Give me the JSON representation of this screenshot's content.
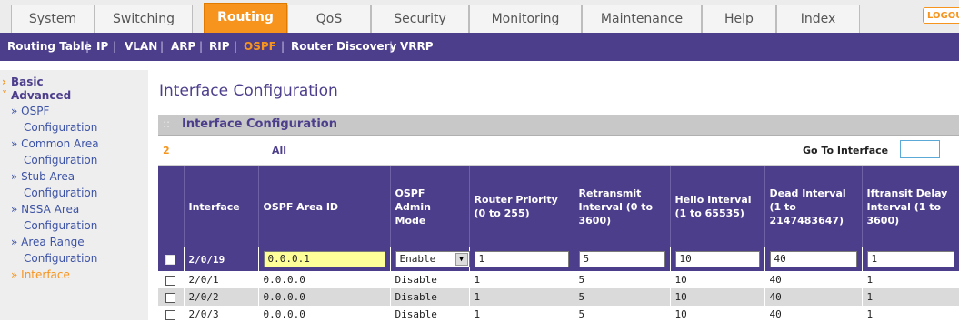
{
  "top_tabs": [
    {
      "label": "System",
      "active": false
    },
    {
      "label": "Switching",
      "active": false
    },
    {
      "label": "Routing",
      "active": true
    },
    {
      "label": "QoS",
      "active": false
    },
    {
      "label": "Security",
      "active": false
    },
    {
      "label": "Monitoring",
      "active": false
    },
    {
      "label": "Maintenance",
      "active": false
    },
    {
      "label": "Help",
      "active": false
    },
    {
      "label": "Index",
      "active": false
    }
  ],
  "logout_label": "LOGOU",
  "subnav": [
    {
      "label": "Routing Table",
      "active": false
    },
    {
      "label": "IP",
      "active": false
    },
    {
      "label": "VLAN",
      "active": false
    },
    {
      "label": "ARP",
      "active": false
    },
    {
      "label": "RIP",
      "active": false
    },
    {
      "label": "OSPF",
      "active": true
    },
    {
      "label": "Router Discovery",
      "active": false
    },
    {
      "label": "VRRP",
      "active": false
    }
  ],
  "sidebar": {
    "basic": "Basic",
    "advanced": "Advanced",
    "items": [
      {
        "line1": "» OSPF",
        "line2": "Configuration"
      },
      {
        "line1": "» Common Area",
        "line2": "Configuration"
      },
      {
        "line1": "» Stub Area",
        "line2": "Configuration"
      },
      {
        "line1": "» NSSA Area",
        "line2": "Configuration"
      },
      {
        "line1": "» Area Range",
        "line2": "Configuration"
      },
      {
        "line1": "» Interface",
        "line2": ""
      }
    ]
  },
  "page_title": "Interface Configuration",
  "section_title": "Interface Configuration",
  "section_marker": "::",
  "controls": {
    "slot": "2",
    "all": "All",
    "goto_label": "Go To Interface",
    "goto_value": ""
  },
  "columns": [
    "Interface",
    "OSPF Area ID",
    "OSPF Admin Mode",
    "Router Priority (0 to 255)",
    "Retransmit Interval (0 to 3600)",
    "Hello Interval (1 to 65535)",
    "Dead Interval (1 to 2147483647)",
    "Iftransit Delay Interval (1 to 3600)"
  ],
  "edit_row": {
    "interface": "2/0/19",
    "area_id": "0.0.0.1",
    "admin_mode": "Enable",
    "priority": "1",
    "retransmit": "5",
    "hello": "10",
    "dead": "40",
    "transit": "1"
  },
  "rows": [
    {
      "interface": "2/0/1",
      "area_id": "0.0.0.0",
      "admin_mode": "Disable",
      "priority": "1",
      "retransmit": "5",
      "hello": "10",
      "dead": "40",
      "transit": "1"
    },
    {
      "interface": "2/0/2",
      "area_id": "0.0.0.0",
      "admin_mode": "Disable",
      "priority": "1",
      "retransmit": "5",
      "hello": "10",
      "dead": "40",
      "transit": "1"
    },
    {
      "interface": "2/0/3",
      "area_id": "0.0.0.0",
      "admin_mode": "Disable",
      "priority": "1",
      "retransmit": "5",
      "hello": "10",
      "dead": "40",
      "transit": "1"
    }
  ]
}
